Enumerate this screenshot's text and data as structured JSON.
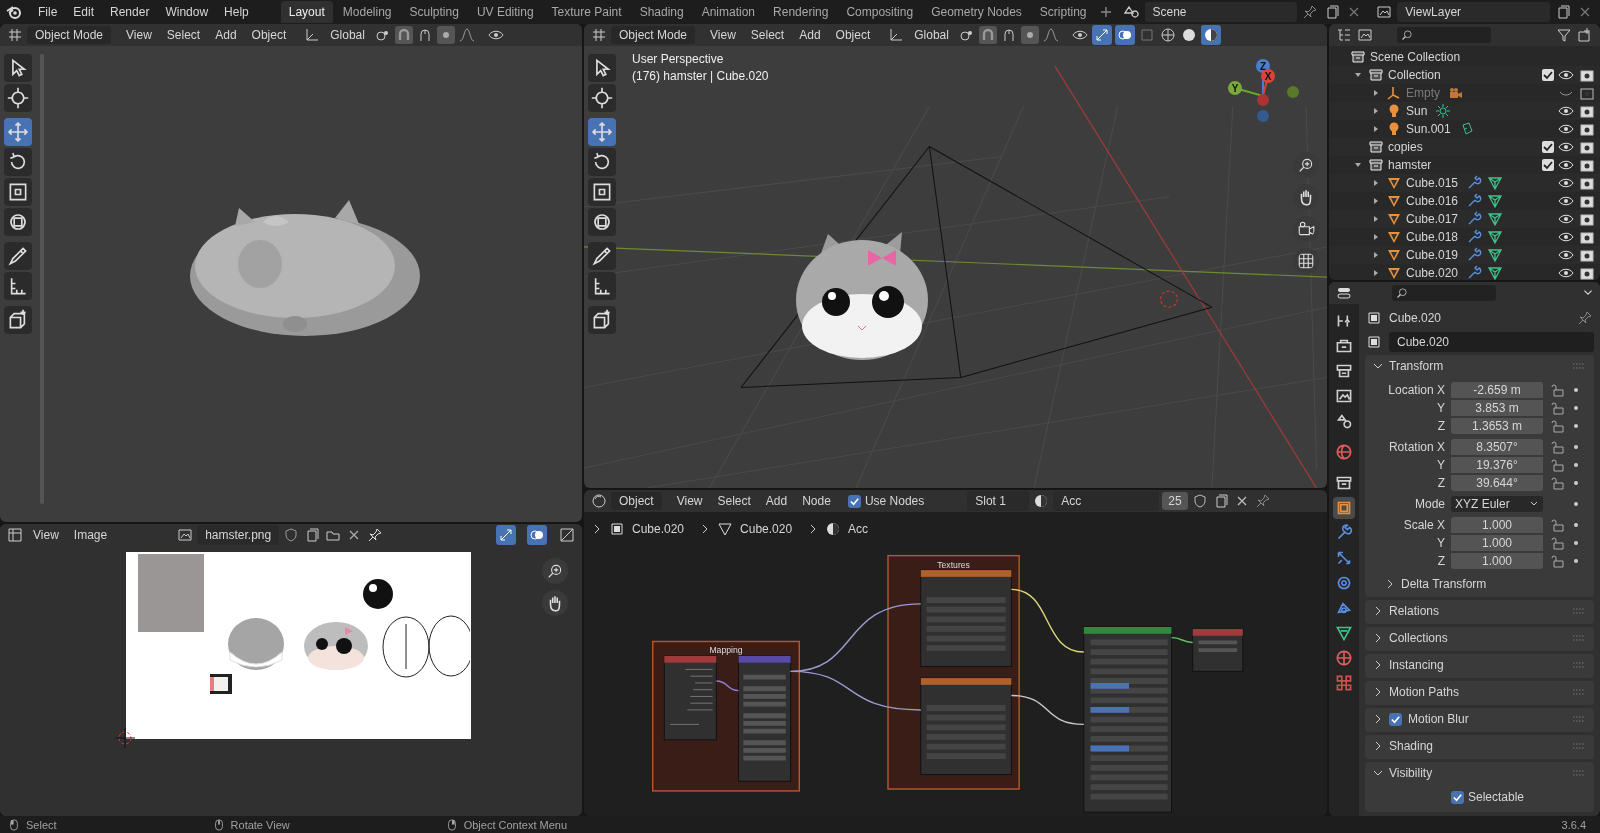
{
  "top_bar": {
    "menus": [
      "File",
      "Edit",
      "Render",
      "Window",
      "Help"
    ],
    "workspaces": [
      {
        "label": "Layout",
        "selected": true
      },
      {
        "label": "Modeling",
        "selected": false
      },
      {
        "label": "Sculpting",
        "selected": false
      },
      {
        "label": "UV Editing",
        "selected": false
      },
      {
        "label": "Texture Paint",
        "selected": false
      },
      {
        "label": "Shading",
        "selected": false
      },
      {
        "label": "Animation",
        "selected": false
      },
      {
        "label": "Rendering",
        "selected": false
      },
      {
        "label": "Compositing",
        "selected": false
      },
      {
        "label": "Geometry Nodes",
        "selected": false
      },
      {
        "label": "Scripting",
        "selected": false
      }
    ],
    "scene": "Scene",
    "view_layer": "ViewLayer"
  },
  "left_viewport": {
    "mode": "Object Mode",
    "menus": [
      "View",
      "Select",
      "Add",
      "Object"
    ],
    "orientation": "Global",
    "tools": [
      {
        "selected": false
      },
      {
        "selected": false
      },
      {
        "selected": true
      },
      {
        "selected": false
      },
      {
        "selected": false
      },
      {
        "selected": false
      },
      {
        "selected": false
      },
      {
        "selected": false
      },
      {
        "selected": false
      }
    ]
  },
  "main_viewport": {
    "mode": "Object Mode",
    "menus": [
      "View",
      "Select",
      "Add",
      "Object"
    ],
    "orientation": "Global",
    "perspective": "User Perspective",
    "info": "(176) hamster | Cube.020",
    "gizmo_axes": [
      "Z",
      "X",
      "Y"
    ],
    "tools": [
      {
        "selected": false
      },
      {
        "selected": false
      },
      {
        "selected": true
      },
      {
        "selected": false
      },
      {
        "selected": false
      },
      {
        "selected": false
      },
      {
        "selected": false
      },
      {
        "selected": false
      },
      {
        "selected": false
      }
    ]
  },
  "image_editor": {
    "menus": [
      "View",
      "Image"
    ],
    "image_name": "hamster.png"
  },
  "node_editor": {
    "object_type": "Object",
    "menus": [
      "View",
      "Select",
      "Add",
      "Node"
    ],
    "use_nodes": {
      "label": "Use Nodes",
      "checked": true
    },
    "slot": "Slot 1",
    "material": "Acc",
    "users": "25",
    "breadcrumbs": [
      "Cube.020",
      "Cube.020",
      "Acc"
    ],
    "frames": [
      {
        "label": "Mapping"
      },
      {
        "label": "Textures"
      }
    ]
  },
  "outliner": {
    "root": {
      "label": "Scene Collection",
      "kind": "scene",
      "children": [
        {
          "label": "Collection",
          "kind": "collection",
          "expanded": true,
          "checked": true,
          "children": [
            {
              "label": "Empty",
              "kind": "empty",
              "expanded": false,
              "visible": false
            },
            {
              "label": "Sun",
              "kind": "light",
              "expanded": false,
              "visible": true
            },
            {
              "label": "Sun.001",
              "kind": "light",
              "expanded": false,
              "visible": true
            }
          ]
        },
        {
          "label": "copies",
          "kind": "collection",
          "checked": true
        },
        {
          "label": "hamster",
          "kind": "collection",
          "expanded": true,
          "checked": true,
          "children": [
            {
              "label": "Cube.015",
              "kind": "mesh",
              "expanded": false,
              "visible": true
            },
            {
              "label": "Cube.016",
              "kind": "mesh",
              "expanded": false,
              "visible": true
            },
            {
              "label": "Cube.017",
              "kind": "mesh",
              "expanded": false,
              "visible": true
            },
            {
              "label": "Cube.018",
              "kind": "mesh",
              "expanded": false,
              "visible": true
            },
            {
              "label": "Cube.019",
              "kind": "mesh",
              "expanded": false,
              "visible": true
            },
            {
              "label": "Cube.020",
              "kind": "mesh",
              "expanded": false,
              "visible": true
            }
          ]
        }
      ]
    }
  },
  "properties": {
    "tabs": [
      {
        "selected": false
      },
      {
        "selected": false
      },
      {
        "selected": false
      },
      {
        "selected": false
      },
      {
        "selected": false
      },
      {
        "selected": false
      },
      {
        "selected": false
      },
      {
        "selected": true
      },
      {
        "selected": false
      },
      {
        "selected": false
      },
      {
        "selected": false
      },
      {
        "selected": false
      },
      {
        "selected": false
      },
      {
        "selected": false
      },
      {
        "selected": false
      }
    ],
    "object_name": "Cube.020",
    "data_name": "Cube.020",
    "transform": {
      "label": "Transform",
      "expanded": true,
      "groups": [
        {
          "rows": [
            {
              "label": "Location X",
              "value": "-2.659 m",
              "kind": "number"
            },
            {
              "label": "Y",
              "value": "3.853 m",
              "kind": "number"
            },
            {
              "label": "Z",
              "value": "1.3653 m",
              "kind": "number"
            }
          ]
        },
        {
          "rows": [
            {
              "label": "Rotation X",
              "value": "8.3507°",
              "kind": "number"
            },
            {
              "label": "Y",
              "value": "19.376°",
              "kind": "number"
            },
            {
              "label": "Z",
              "value": "39.644°",
              "kind": "number"
            }
          ]
        },
        {
          "rows": [
            {
              "label": "Mode",
              "value": "XYZ Euler",
              "kind": "dropdown"
            }
          ]
        },
        {
          "rows": [
            {
              "label": "Scale X",
              "value": "1.000",
              "kind": "number"
            },
            {
              "label": "Y",
              "value": "1.000",
              "kind": "number"
            },
            {
              "label": "Z",
              "value": "1.000",
              "kind": "number"
            }
          ]
        }
      ],
      "subpanel": {
        "label": "Delta Transform",
        "expanded": false
      }
    },
    "panels": [
      {
        "label": "Relations",
        "expanded": false
      },
      {
        "label": "Collections",
        "expanded": false
      },
      {
        "label": "Instancing",
        "expanded": false
      },
      {
        "label": "Motion Paths",
        "expanded": false
      },
      {
        "label": "Motion Blur",
        "expanded": false,
        "checked": true
      },
      {
        "label": "Shading",
        "expanded": false
      },
      {
        "label": "Visibility",
        "expanded": true,
        "options": [
          {
            "label": "Selectable",
            "checked": true
          }
        ]
      }
    ]
  },
  "status_bar": {
    "hints": [
      "Select",
      "Rotate View",
      "Object Context Menu"
    ],
    "version": "3.6.4"
  }
}
